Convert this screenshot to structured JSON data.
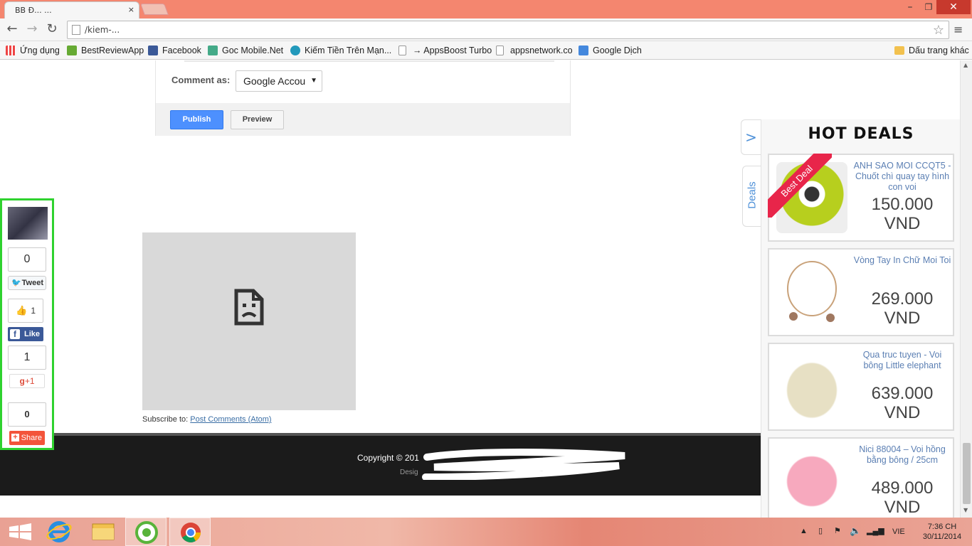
{
  "browser": {
    "tab_title": "BB Đ... ...",
    "tab_close": "×",
    "window_controls": {
      "minimize": "–",
      "maximize": "❐",
      "close": "✕"
    },
    "nav": {
      "back": "←",
      "forward": "→",
      "reload": "↻"
    },
    "url": "                                   /kiem-...",
    "star": "☆",
    "menu": "≡"
  },
  "bookmarks": [
    {
      "label": "Ứng dụng",
      "icon": "apps-grid-icon",
      "color": "#e44"
    },
    {
      "label": "BestReviewApp",
      "icon": "cube-icon",
      "color": "#6a3"
    },
    {
      "label": "Facebook",
      "icon": "facebook-icon",
      "color": "#3b5998"
    },
    {
      "label": "Goc Mobile.Net",
      "icon": "gocmobile-icon",
      "color": "#4a8"
    },
    {
      "label": "Kiếm Tiền Trên Mạn...",
      "icon": "s-circle-icon",
      "color": "#29b"
    },
    {
      "label": "→ AppsBoost Turbo",
      "icon": "page-icon",
      "color": "#ddd"
    },
    {
      "label": "appsnetwork.co",
      "icon": "page-icon",
      "color": "#ddd"
    },
    {
      "label": "Google Dịch",
      "icon": "translate-icon",
      "color": "#48d"
    },
    {
      "label": "Dấu trang khác",
      "icon": "folder-icon",
      "color": "#f2c14e"
    }
  ],
  "comment": {
    "label": "Comment as:",
    "account": "Google Accou",
    "publish": "Publish",
    "preview": "Preview"
  },
  "subscribe": {
    "prefix": "Subscribe to:",
    "link": "Post Comments (Atom)"
  },
  "footer": {
    "copyright": "Copyright © 201",
    "designed": "Desig"
  },
  "social": {
    "tweet_count": "0",
    "tweet_label": "Tweet",
    "fb_count": "1",
    "fb_label": "Like",
    "gplus_count": "1",
    "gplus_label": "+1",
    "share_count": "0",
    "share_label": "Share"
  },
  "deals": {
    "title": "HOT DEALS",
    "toggle": ">",
    "tab_label": "Deals",
    "ribbon": "Best Deal",
    "items": [
      {
        "name": "ANH SAO MOI CCQT5 - Chuốt chì quay tay hình con voi",
        "price": "150.000 VND"
      },
      {
        "name": "Vòng Tay In Chữ Moi Toi",
        "price": "269.000 VND"
      },
      {
        "name": "Qua truc tuyen - Voi bông Little elephant",
        "price": "639.000 VND"
      },
      {
        "name": "Nici 88004 – Voi hồng bằng bông / 25cm",
        "price": "489.000 VND"
      }
    ]
  },
  "taskbar": {
    "time": "7:36 CH",
    "date": "30/11/2014",
    "lang": "VIE"
  },
  "colors": {
    "accent_green": "#2fd22f",
    "publish_blue": "#4d90fe",
    "deal_link": "#5b7fb3",
    "ribbon_red": "#e8254a"
  }
}
